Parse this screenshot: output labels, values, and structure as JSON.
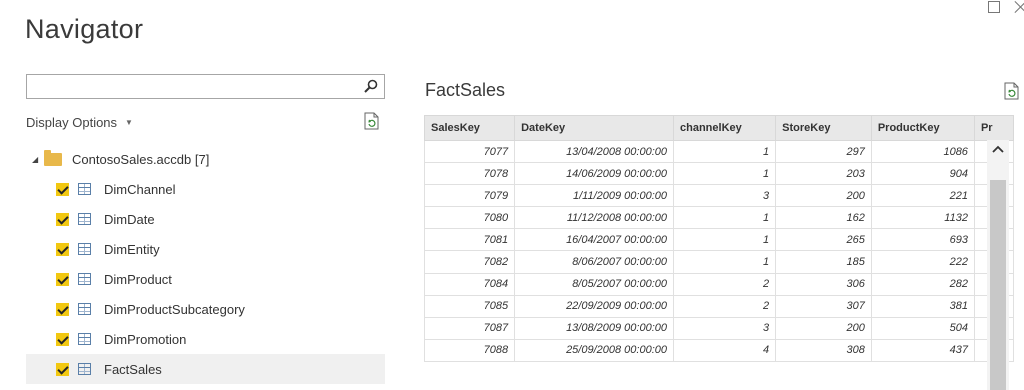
{
  "window": {
    "title": "Navigator"
  },
  "left": {
    "search": {
      "value": "",
      "placeholder": ""
    },
    "display_options_label": "Display Options",
    "tree": {
      "root_label": "ContosoSales.accdb [7]",
      "items": [
        {
          "label": "DimChannel",
          "checked": true
        },
        {
          "label": "DimDate",
          "checked": true
        },
        {
          "label": "DimEntity",
          "checked": true
        },
        {
          "label": "DimProduct",
          "checked": true
        },
        {
          "label": "DimProductSubcategory",
          "checked": true
        },
        {
          "label": "DimPromotion",
          "checked": true
        },
        {
          "label": "FactSales",
          "checked": true,
          "selected": true
        }
      ]
    }
  },
  "preview": {
    "title": "FactSales",
    "columns": [
      "SalesKey",
      "DateKey",
      "channelKey",
      "StoreKey",
      "ProductKey",
      "Pr"
    ],
    "rows": [
      [
        "7077",
        "13/04/2008 00:00:00",
        "1",
        "297",
        "1086"
      ],
      [
        "7078",
        "14/06/2009 00:00:00",
        "1",
        "203",
        "904"
      ],
      [
        "7079",
        "1/11/2009 00:00:00",
        "3",
        "200",
        "221"
      ],
      [
        "7080",
        "11/12/2008 00:00:00",
        "1",
        "162",
        "1132"
      ],
      [
        "7081",
        "16/04/2007 00:00:00",
        "1",
        "265",
        "693"
      ],
      [
        "7082",
        "8/06/2007 00:00:00",
        "1",
        "185",
        "222"
      ],
      [
        "7084",
        "8/05/2007 00:00:00",
        "2",
        "306",
        "282"
      ],
      [
        "7085",
        "22/09/2009 00:00:00",
        "2",
        "307",
        "381"
      ],
      [
        "7087",
        "13/08/2009 00:00:00",
        "3",
        "200",
        "504"
      ],
      [
        "7088",
        "25/09/2008 00:00:00",
        "4",
        "308",
        "437"
      ]
    ]
  },
  "icons": {
    "search": "search-icon",
    "refresh": "refresh-icon",
    "folder": "folder-icon",
    "table": "table-icon",
    "checkbox": "checkbox-checked-icon"
  },
  "colors": {
    "accent": "#f2c811",
    "folder": "#e8b84a",
    "header_bg": "#e8e8e8"
  }
}
